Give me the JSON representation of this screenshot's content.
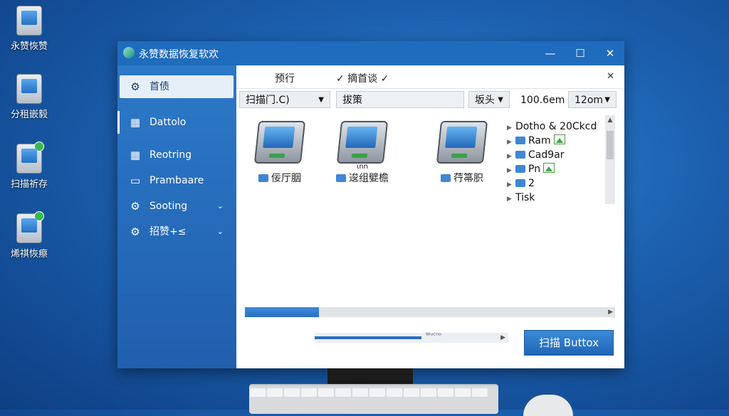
{
  "desktop": {
    "icons": [
      {
        "label": "永赞恢赞"
      },
      {
        "label": "分租嵌毅"
      },
      {
        "label": "扫描祈存"
      },
      {
        "label": "烯祺恢瘵"
      }
    ]
  },
  "window": {
    "title": "永赞数据恢复软欢",
    "controls": {
      "minimize": "—",
      "maximize": "☐",
      "close": "✕"
    }
  },
  "sidebar": {
    "items": [
      {
        "label": "首债",
        "icon": "gear-icon"
      },
      {
        "label": "Dattolo",
        "icon": "grid-icon"
      },
      {
        "label": "Reotring",
        "icon": "grid-icon"
      },
      {
        "label": "Prambaare",
        "icon": "page-icon"
      },
      {
        "label": "Sooting",
        "icon": "gear-icon",
        "chevron": "⌄"
      },
      {
        "label": "招赞+≤",
        "icon": "gear-icon",
        "chevron": "⌄"
      }
    ]
  },
  "tabs": {
    "items": [
      {
        "label": "预行"
      },
      {
        "label": "✓ 摘首谈 ✓"
      }
    ],
    "close": "✕"
  },
  "toolbar": {
    "scan_select": "扫描门.C)",
    "search_field": "拔策",
    "sort_select": "坂头",
    "size_value": "100.6em",
    "size_select": "12om"
  },
  "files": {
    "items": [
      {
        "label": "佞厅胭",
        "caption": ""
      },
      {
        "label": "逡组嬖檐",
        "caption": "ιnn"
      },
      {
        "label": "荇箒胑",
        "caption": ""
      }
    ]
  },
  "tree": {
    "items": [
      {
        "label": "Dotho & 20Ckcd"
      },
      {
        "label": "Ram"
      },
      {
        "label": "Cad9ar"
      },
      {
        "label": "Pn"
      },
      {
        "label": "2"
      },
      {
        "label": "Tisk"
      }
    ]
  },
  "horizontal_scroll": {
    "fraction": 0.2
  },
  "progress": {
    "fraction": 0.55,
    "caption": "ᵂᵘᶜⁿᵒ"
  },
  "scan_button": {
    "label": "扫描 Buttox"
  }
}
